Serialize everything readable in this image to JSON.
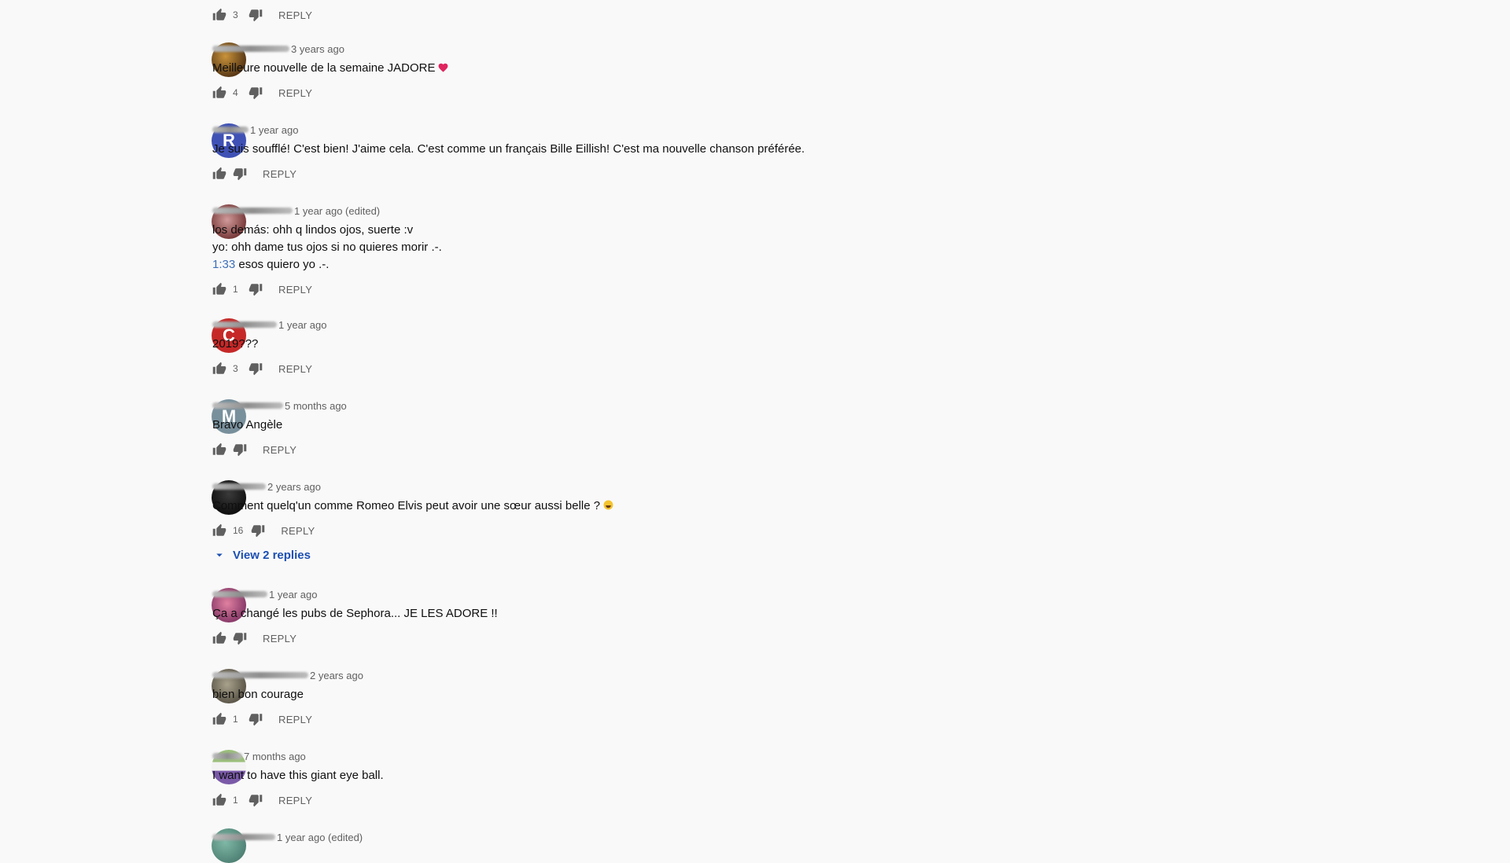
{
  "comments": [
    {
      "time": "",
      "text": "",
      "likes": "3",
      "reply": "REPLY"
    },
    {
      "time": "3 years ago",
      "text": "Meilleure nouvelle de la semaine JADORE",
      "likes": "4",
      "reply": "REPLY"
    },
    {
      "avatar_letter": "R",
      "time": "1 year ago",
      "text": "Je suis soufflé! C'est bien! J'aime cela. C'est comme un français Bille Eillish! C'est ma nouvelle chanson préférée.",
      "likes": "",
      "reply": "REPLY"
    },
    {
      "time": "1 year ago (edited)",
      "text_line1": "los demás: ohh q lindos ojos,  suerte :v",
      "text_line2": "yo: ohh dame tus ojos si no quieres morir .-.",
      "timestamp_link": "1:33",
      "text_line3": " esos quiero yo .-.",
      "likes": "1",
      "reply": "REPLY"
    },
    {
      "avatar_letter": "C",
      "time": "1 year ago",
      "text": "2019???",
      "likes": "3",
      "reply": "REPLY"
    },
    {
      "avatar_letter": "M",
      "time": "5 months ago",
      "text": "Bravo Angèle",
      "likes": "",
      "reply": "REPLY"
    },
    {
      "time": "2 years ago",
      "text": "Comment quelq'un comme Romeo Elvis peut avoir une sœur aussi belle ?",
      "likes": "16",
      "reply": "REPLY",
      "view_replies": "View 2 replies"
    },
    {
      "time": "1 year ago",
      "text": "Ça a changé les pubs de Sephora... JE LES ADORE !!",
      "likes": "",
      "reply": "REPLY"
    },
    {
      "time": "2 years ago",
      "text": "bien bon courage",
      "likes": "1",
      "reply": "REPLY"
    },
    {
      "time": "7 months ago",
      "text": "I want to have this giant eye ball.",
      "likes": "1",
      "reply": "REPLY"
    },
    {
      "time": "1 year ago (edited)"
    }
  ],
  "icons": {
    "like": "thumb-up-icon",
    "dislike": "thumb-down-icon",
    "expand": "caret-down-icon"
  },
  "colors": {
    "link": "#1c4fb3",
    "timestamp_link": "#3d6fb8",
    "avatar_R": "#3f51b5",
    "avatar_C": "#c62828",
    "avatar_M": "#78909c"
  }
}
